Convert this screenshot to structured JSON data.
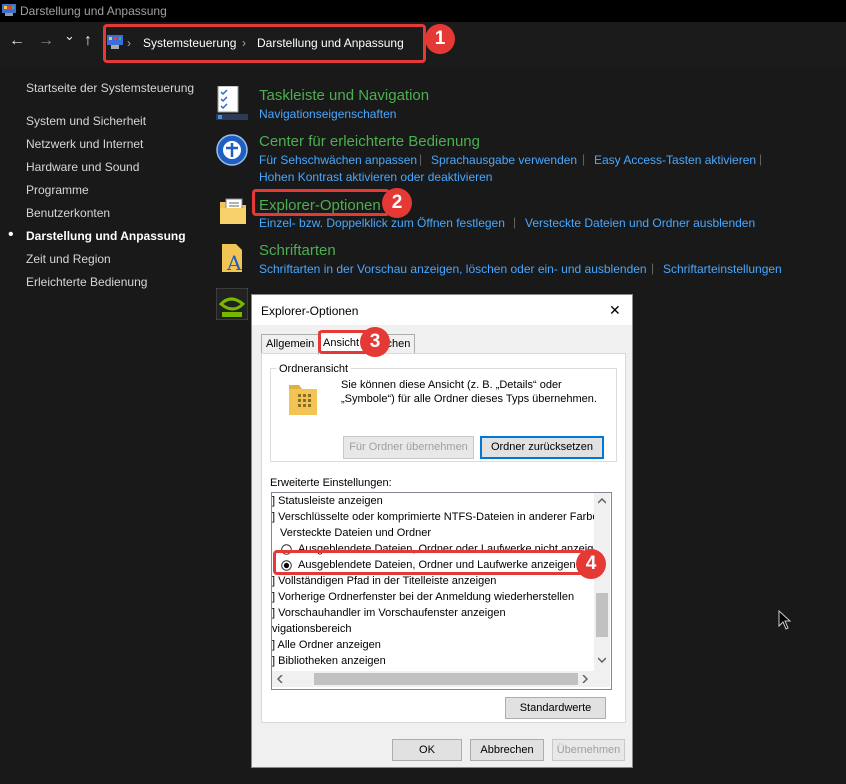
{
  "window": {
    "title": "Darstellung und Anpassung"
  },
  "nav": {
    "back": "←",
    "forward": "→",
    "dropdown": "⌄",
    "up": "↑",
    "breadcrumb": [
      "Systemsteuerung",
      "Darstellung und Anpassung"
    ],
    "sep": "›"
  },
  "annotations": {
    "a1": "1",
    "a2": "2",
    "a3": "3",
    "a4": "4"
  },
  "sidebar": {
    "home": "Startseite der Systemsteuerung",
    "items": [
      {
        "label": "System und Sicherheit"
      },
      {
        "label": "Netzwerk und Internet"
      },
      {
        "label": "Hardware und Sound"
      },
      {
        "label": "Programme"
      },
      {
        "label": "Benutzerkonten"
      },
      {
        "label": "Darstellung und Anpassung",
        "active": true
      },
      {
        "label": "Zeit und Region"
      },
      {
        "label": "Erleichterte Bedienung"
      }
    ],
    "bullet": "•"
  },
  "categories": {
    "taskbar": {
      "title": "Taskleiste und Navigation",
      "links": [
        "Navigationseigenschaften"
      ]
    },
    "ease": {
      "title": "Center für erleichterte Bedienung",
      "links": [
        "Für Sehschwächen anpassen",
        "Sprachausgabe verwenden",
        "Easy Access-Tasten aktivieren",
        "Hohen Kontrast aktivieren oder deaktivieren"
      ]
    },
    "explorer": {
      "title": "Explorer-Optionen",
      "links": [
        "Einzel- bzw. Doppelklick zum Öffnen festlegen",
        "Versteckte Dateien und Ordner ausblenden"
      ]
    },
    "fonts": {
      "title": "Schriftarten",
      "links": [
        "Schriftarten in der Vorschau anzeigen, löschen oder ein- und ausblenden",
        "Schriftarteinstellungen"
      ]
    },
    "sep": "|"
  },
  "dialog": {
    "title": "Explorer-Optionen",
    "close": "✕",
    "tabs": [
      "Allgemein",
      "Ansicht",
      "Suchen"
    ],
    "folder_view": {
      "legend": "Ordneransicht",
      "text": "Sie können diese Ansicht (z. B. „Details“ oder „Symbole“) für alle Ordner dieses Typs übernehmen.",
      "apply_btn": "Für Ordner übernehmen",
      "reset_btn": "Ordner zurücksetzen"
    },
    "advanced": {
      "label": "Erweiterte Einstellungen:",
      "rows": [
        "] Statusleiste anzeigen",
        "] Verschlüsselte oder komprimierte NTFS-Dateien in anderer Farbe a",
        "Versteckte Dateien und Ordner",
        "Ausgeblendete Dateien, Ordner oder Laufwerke nicht anzeigen",
        "Ausgeblendete Dateien, Ordner und Laufwerke anzeigen",
        "] Vollständigen Pfad in der Titelleiste anzeigen",
        "] Vorherige Ordnerfenster bei der Anmeldung wiederherstellen",
        "] Vorschauhandler im Vorschaufenster anzeigen",
        "vigationsbereich",
        "] Alle Ordner anzeigen",
        "] Bibliotheken anzeigen"
      ]
    },
    "defaults_btn": "Standardwerte",
    "ok": "OK",
    "cancel": "Abbrechen",
    "apply": "Übernehmen"
  },
  "colors": {
    "accent": "#e53935",
    "link": "#47a8ff",
    "category": "#4caf50"
  }
}
